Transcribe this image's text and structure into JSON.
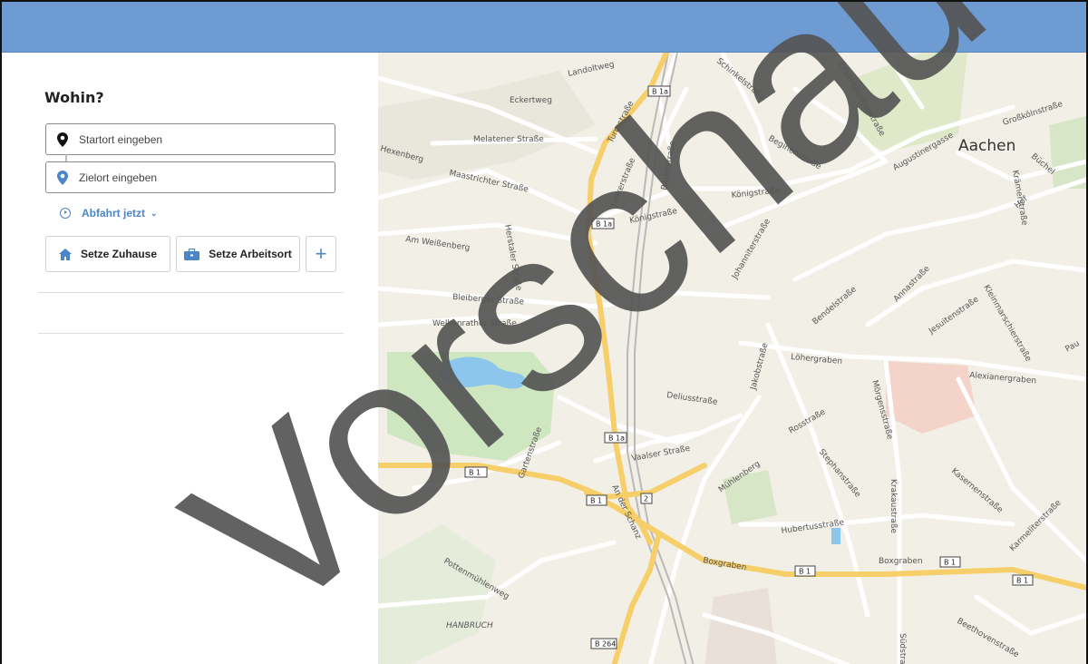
{
  "panel": {
    "title": "Wohin?",
    "start": {
      "placeholder": "Startort eingeben",
      "icon": "map-pin-icon"
    },
    "destination": {
      "placeholder": "Zielort eingeben",
      "icon": "map-pin-icon"
    },
    "departure": {
      "label": "Abfahrt jetzt",
      "icon": "clock-icon"
    },
    "buttons": {
      "home": {
        "label": "Setze Zuhause",
        "icon": "home-icon"
      },
      "work": {
        "label": "Setze Arbeitsort",
        "icon": "briefcase-icon"
      },
      "add": {
        "label": "+",
        "icon": "plus-icon"
      }
    }
  },
  "map": {
    "city": "Aachen",
    "district": "HANBRUCH",
    "streets": {
      "s1": "Landoltweg",
      "s2": "Eckertweg",
      "s3": "Melatener Straße",
      "s4": "Maastrichter Straße",
      "s5": "Hexenberg",
      "s6": "Am Weißenberg",
      "s7": "Herstaler Straße",
      "s8": "Bleiberger Straße",
      "s9": "Welkenrather Straße",
      "s10": "Turmstraße",
      "s11": "Junkerstraße",
      "s12": "Bärenstraße",
      "s13": "Königstraße",
      "s14": "Schinkelstraße",
      "s15": "Augustinergasse",
      "s16": "Löhergraben",
      "s17": "Alexianergraben",
      "s18": "Boxgraben",
      "s19": "Vaalser Straße",
      "s20": "Deliusstraße",
      "s21": "Mühlenberg",
      "s22": "Rosstraße",
      "s23": "Jakobstraße",
      "s24": "Pottenmühlenweg",
      "s25": "Hubertusstraße",
      "s26": "Bendelstraße",
      "s27": "Jesuitenstraße",
      "s28": "Annastraße",
      "s29": "Kasernenstraße",
      "s30": "Kleinmarschierstraße",
      "s31": "Karmeliterstraße",
      "s32": "Beethovenstraße",
      "s33": "Krakaustraße",
      "s34": "Stephanstraße",
      "s35": "Mörgensstraße",
      "s36": "An der Schanz",
      "s37": "Gartenstraße",
      "s38": "Beginenstraße",
      "s39": "Elisenbrunnenstraße",
      "s40": "Großkölnstraße",
      "s41": "Krämerstraße",
      "s42": "Hof",
      "s43": "Büchel",
      "s44": "Pau",
      "s45": "Johanniterstraße",
      "s46": "Pützstraße",
      "s47": "Südstraße"
    },
    "shields": [
      "B 1a",
      "B 1a",
      "B 1a",
      "B 1",
      "B 1",
      "B 1",
      "B 1",
      "2",
      "B 264",
      "B 1"
    ]
  },
  "watermark": "Vorschau",
  "colors": {
    "header": "#6d9bd2",
    "accent": "#4a86c8",
    "road_major": "#f6cf6b"
  }
}
